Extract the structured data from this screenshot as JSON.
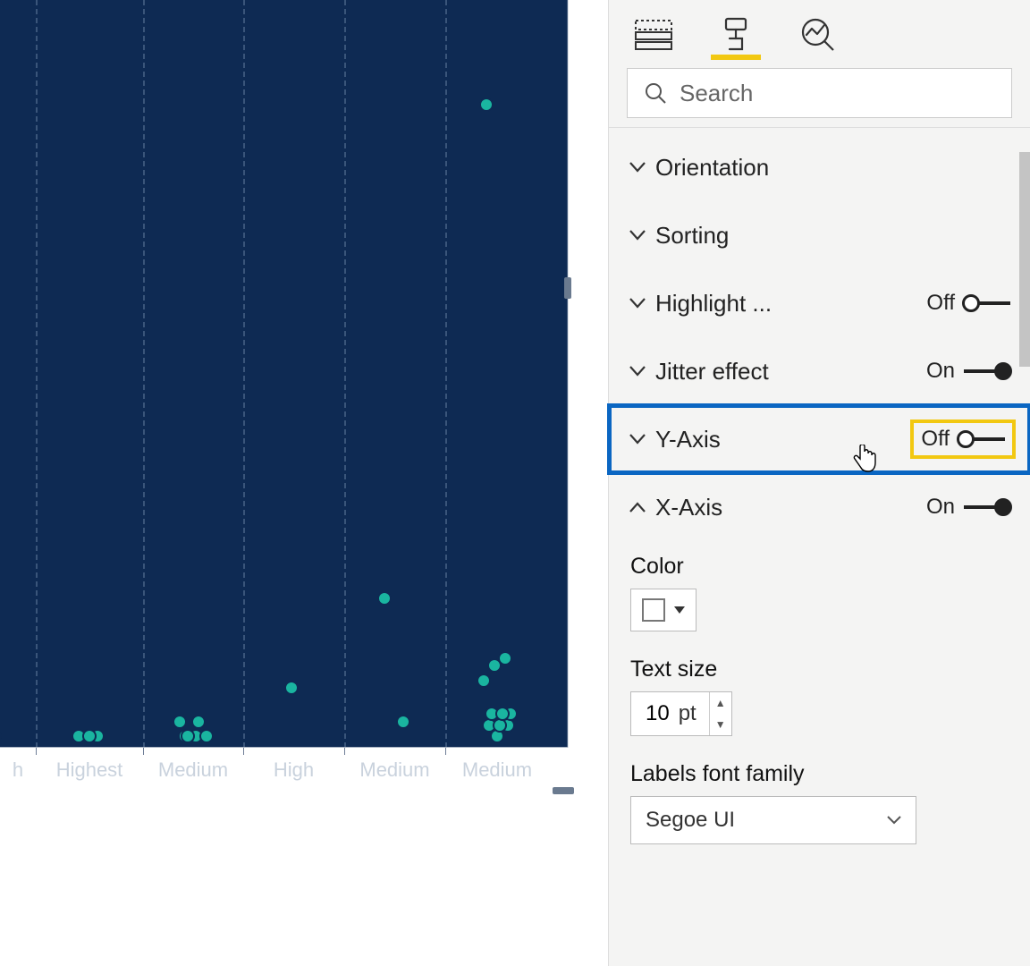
{
  "tabs": {
    "fields_icon": "fields-icon",
    "format_icon": "format-icon",
    "analytics_icon": "analytics-icon",
    "active": "format"
  },
  "search": {
    "placeholder": "Search"
  },
  "sections": {
    "orientation": {
      "label": "Orientation"
    },
    "sorting": {
      "label": "Sorting"
    },
    "highlight": {
      "label": "Highlight ...",
      "state_text": "Off",
      "on": false
    },
    "jitter": {
      "label": "Jitter effect",
      "state_text": "On",
      "on": true
    },
    "yaxis": {
      "label": "Y-Axis",
      "state_text": "Off",
      "on": false
    },
    "xaxis": {
      "label": "X-Axis",
      "state_text": "On",
      "on": true
    }
  },
  "xaxis_sub": {
    "color_label": "Color",
    "text_size_label": "Text size",
    "text_size_value": "10",
    "text_size_unit": "pt",
    "font_family_label": "Labels font family",
    "font_family_value": "Segoe UI"
  },
  "chart_data": {
    "type": "scatter",
    "xlabel": "",
    "ylabel": "",
    "categories": [
      "h",
      "Highest",
      "Medium",
      "High",
      "Medium",
      "Medium"
    ],
    "title": "",
    "ylim": [
      0,
      100
    ],
    "series": [
      {
        "name": "points",
        "points": [
          {
            "cat_index": 0,
            "y": 1.5
          },
          {
            "cat_index": 1,
            "y": 1.5
          },
          {
            "cat_index": 1,
            "y": 1.5
          },
          {
            "cat_index": 1,
            "y": 1.5
          },
          {
            "cat_index": 1,
            "y": 1.5
          },
          {
            "cat_index": 2,
            "y": 1.5
          },
          {
            "cat_index": 2,
            "y": 1.5
          },
          {
            "cat_index": 2,
            "y": 1.5
          },
          {
            "cat_index": 2,
            "y": 1.5
          },
          {
            "cat_index": 2,
            "y": 1.5
          },
          {
            "cat_index": 2,
            "y": 3.5
          },
          {
            "cat_index": 2,
            "y": 3.5
          },
          {
            "cat_index": 3,
            "y": 8
          },
          {
            "cat_index": 4,
            "y": 3.5
          },
          {
            "cat_index": 4,
            "y": 20
          },
          {
            "cat_index": 5,
            "y": 1.5
          },
          {
            "cat_index": 5,
            "y": 3
          },
          {
            "cat_index": 5,
            "y": 3
          },
          {
            "cat_index": 5,
            "y": 3
          },
          {
            "cat_index": 5,
            "y": 4.5
          },
          {
            "cat_index": 5,
            "y": 4.5
          },
          {
            "cat_index": 5,
            "y": 4.5
          },
          {
            "cat_index": 5,
            "y": 9
          },
          {
            "cat_index": 5,
            "y": 11
          },
          {
            "cat_index": 5,
            "y": 12
          },
          {
            "cat_index": 5,
            "y": 86
          }
        ]
      }
    ]
  }
}
